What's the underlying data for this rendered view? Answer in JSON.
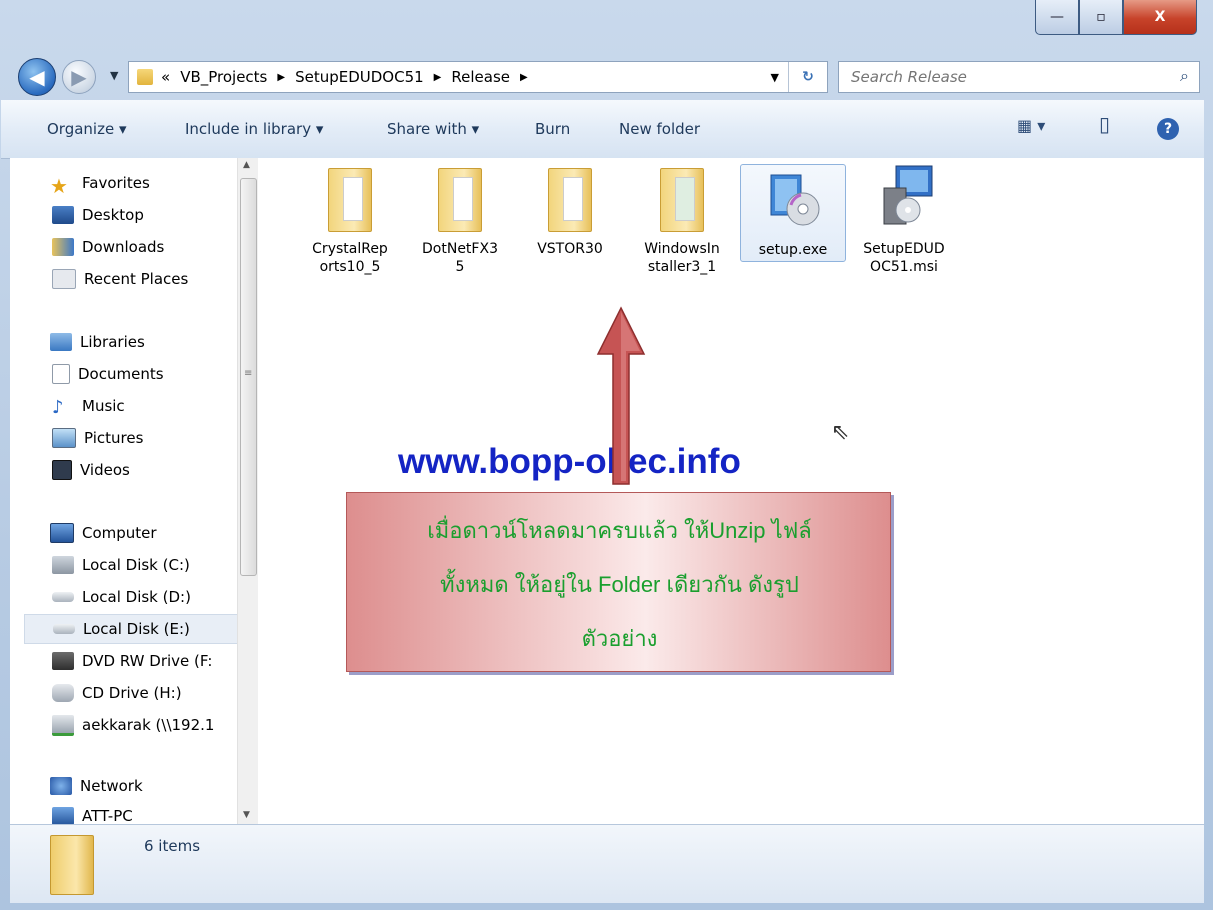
{
  "window": {
    "controls": {
      "minimize": "—",
      "maximize": "▫",
      "close": "X"
    }
  },
  "nav": {
    "back_icon": "◀",
    "forward_icon": "▶",
    "dropdown_icon": "▼",
    "breadcrumb_prefix": "«",
    "breadcrumbs": [
      "VB_Projects",
      "SetupEDUDOC51",
      "Release"
    ],
    "crumb_separator": "▶",
    "address_dropdown": "▼",
    "refresh_icon": "↻",
    "search_placeholder": "Search Release",
    "search_icon": "⌕"
  },
  "toolbar": {
    "organize": "Organize ▾",
    "include_in_library": "Include in library ▾",
    "share_with": "Share with ▾",
    "burn": "Burn",
    "new_folder": "New folder",
    "view_icon": "▦ ▾",
    "preview_pane_icon": "▯",
    "help_icon": "?"
  },
  "sidebar": {
    "favorites": {
      "label": "Favorites",
      "items": [
        "Desktop",
        "Downloads",
        "Recent Places"
      ]
    },
    "libraries": {
      "label": "Libraries",
      "items": [
        "Documents",
        "Music",
        "Pictures",
        "Videos"
      ]
    },
    "computer": {
      "label": "Computer",
      "items": [
        "Local Disk (C:)",
        "Local Disk (D:)",
        "Local Disk (E:)",
        "DVD RW Drive (F:",
        "CD Drive (H:)",
        "aekkarak (\\\\192.1"
      ]
    },
    "network": {
      "label": "Network",
      "items": [
        "ATT-PC"
      ]
    }
  },
  "files": [
    {
      "name_line1": "CrystalRep",
      "name_line2": "orts10_5",
      "type": "folder"
    },
    {
      "name_line1": "DotNetFX3",
      "name_line2": "5",
      "type": "folder"
    },
    {
      "name_line1": "VSTOR30",
      "name_line2": "",
      "type": "folder"
    },
    {
      "name_line1": "WindowsIn",
      "name_line2": "staller3_1",
      "type": "folder"
    },
    {
      "name_line1": "setup.exe",
      "name_line2": "",
      "type": "exe"
    },
    {
      "name_line1": "SetupEDUD",
      "name_line2": "OC51.msi",
      "type": "msi"
    }
  ],
  "overlay": {
    "watermark": "www.bopp-obec.info",
    "banner_line1": "เมื่อดาวน์โหลดมาครบแล้ว ให้Unzip ไฟล์",
    "banner_line2": "ทั้งหมด ให้อยู่ใน Folder เดียวกัน ดังรูป",
    "banner_line3": "ตัวอย่าง"
  },
  "status": {
    "item_count": "6 items"
  },
  "colors": {
    "watermark": "#1424c4",
    "banner_text": "#1a9f2e",
    "arrow": "#c65454"
  }
}
